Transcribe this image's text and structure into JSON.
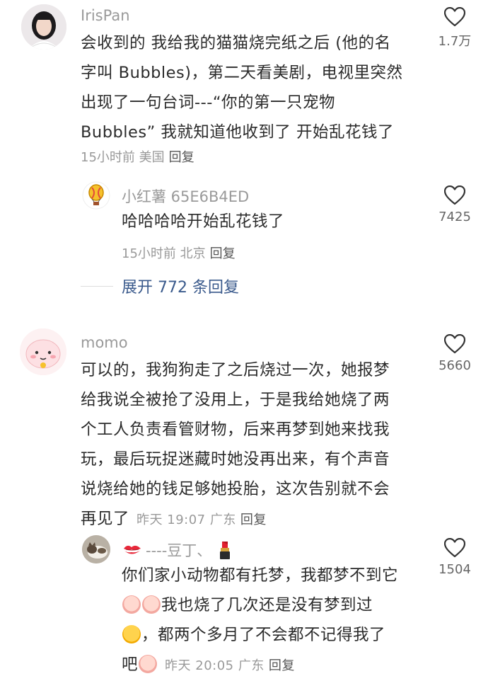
{
  "comments": [
    {
      "user": "IrisPan",
      "text_lines": [
        "会收到的 我给我的猫猫烧完纸之后 (他的名",
        "字叫 Bubbles)，第二天看美剧，电视里突然",
        "出现了一句台词---“你的第一只宠物",
        "Bubbles” 我就知道他收到了 开始乱花钱了"
      ],
      "meta": "15小时前 美国",
      "reply_label": "回复",
      "likes": "1.7万",
      "replies": [
        {
          "user": "小红薯 65E6B4ED",
          "text": "哈哈哈哈开始乱花钱了",
          "meta": "15小时前 北京",
          "reply_label": "回复",
          "likes": "7425"
        }
      ],
      "expand_label": "展开 772 条回复"
    },
    {
      "user": "momo",
      "text_lines": [
        "可以的，我狗狗走了之后烧过一次，她报梦",
        "给我说全被抢了没用上，于是我给她烧了两",
        "个工人负责看管财物，后来再梦到她来找我",
        "玩，最后玩捉迷藏时她没再出来，有个声音",
        "说烧给她的钱足够她投胎，这次告别就不会",
        "再见了"
      ],
      "meta": "昨天 19:07 广东",
      "reply_label": "回复",
      "likes": "5660",
      "replies": [
        {
          "user_prefix_icon": "kiss-mark-icon",
          "user": "----豆丁、",
          "user_suffix_icon": "lipstick-icon",
          "text_lines": [
            "你们家小动物都有托梦，我都梦不到它",
            "我也烧了几次还是没有梦到过",
            "，都两个多月了不会都不记得我了",
            "吧"
          ],
          "meta": "昨天 20:05 广东",
          "reply_label": "回复",
          "likes": "1504"
        }
      ]
    }
  ],
  "icons": {
    "like": "heart-outline-icon",
    "crying_sticker": "crying-sticker-icon",
    "sob_emoji": "loudly-crying-face-icon"
  },
  "colors": {
    "expand_link": "#3a5a8c",
    "meta": "#999999",
    "username": "#9a9a9a"
  }
}
